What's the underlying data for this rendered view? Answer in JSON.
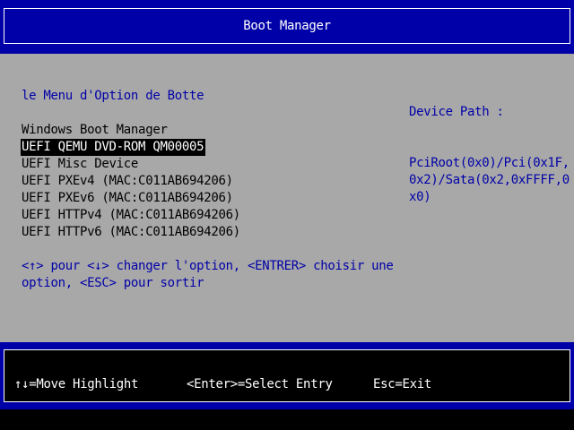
{
  "header": {
    "title": "Boot Manager"
  },
  "menu": {
    "heading": "le Menu d'Option de Botte",
    "items": [
      {
        "label": "Windows Boot Manager"
      },
      {
        "label": "UEFI QEMU DVD-ROM QM00005",
        "selected": true
      },
      {
        "label": "UEFI Misc Device"
      },
      {
        "label": "UEFI PXEv4 (MAC:C011AB694206)"
      },
      {
        "label": "UEFI PXEv6 (MAC:C011AB694206)"
      },
      {
        "label": "UEFI HTTPv4 (MAC:C011AB694206)"
      },
      {
        "label": "UEFI HTTPv6 (MAC:C011AB694206)"
      }
    ],
    "help_line_1": "<↑> pour <↓> changer l'option, <ENTRER> choisir une",
    "help_line_2": "option, <ESC> pour sortir"
  },
  "device_path": {
    "label": "Device Path :",
    "value": "PciRoot(0x0)/Pci(0x1F,\n0x2)/Sata(0x2,0xFFFF,0\nx0)"
  },
  "footer": {
    "move_highlight": "↑↓=Move Highlight",
    "select_entry": "<Enter>=Select Entry",
    "exit": "Esc=Exit"
  },
  "colors": {
    "background": "#a8a8a8",
    "header_blue": "#0000a8",
    "text_blue": "#0000a8",
    "footer_black": "#000000",
    "white": "#ffffff"
  }
}
